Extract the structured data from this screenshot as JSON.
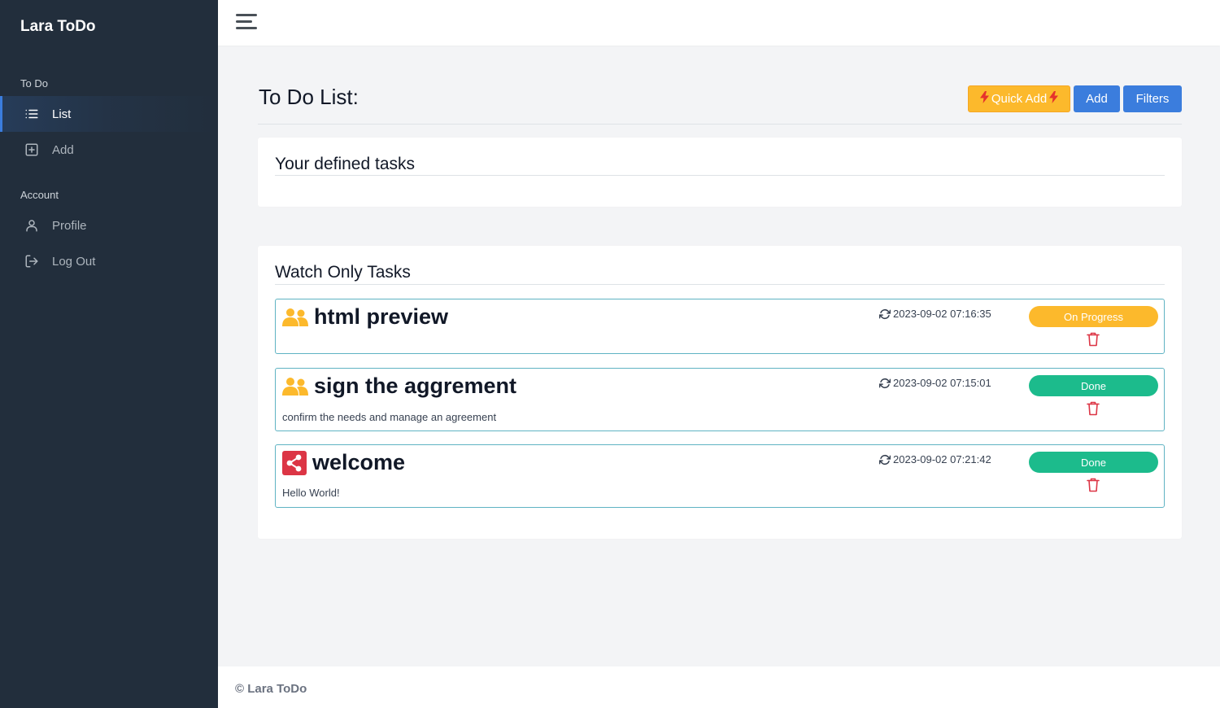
{
  "app": {
    "brand": "Lara ToDo"
  },
  "sidebar": {
    "sections": [
      {
        "header": "To Do",
        "items": [
          {
            "label": "List",
            "icon": "list-icon",
            "active": true
          },
          {
            "label": "Add",
            "icon": "plus-square-icon",
            "active": false
          }
        ]
      },
      {
        "header": "Account",
        "items": [
          {
            "label": "Profile",
            "icon": "user-icon",
            "active": false
          },
          {
            "label": "Log Out",
            "icon": "log-out-icon",
            "active": false
          }
        ]
      }
    ]
  },
  "main": {
    "title": "To Do List:",
    "buttons": {
      "quick_add": "Quick Add",
      "add": "Add",
      "filters": "Filters"
    },
    "defined_card": {
      "title": "Your defined tasks"
    },
    "watch_card": {
      "title": "Watch Only Tasks",
      "tasks": [
        {
          "title": "html preview",
          "icon": "users-icon",
          "description": "",
          "timestamp": "2023-09-02 07:16:35",
          "status": "On Progress"
        },
        {
          "title": "sign the aggrement",
          "icon": "users-icon",
          "description": "confirm the needs and manage an agreement",
          "timestamp": "2023-09-02 07:15:01",
          "status": "Done"
        },
        {
          "title": "welcome",
          "icon": "share-icon",
          "description": "Hello World!",
          "timestamp": "2023-09-02 07:21:42",
          "status": "Done"
        }
      ]
    }
  },
  "footer": {
    "text": "© Lara ToDo"
  },
  "colors": {
    "sidebar_bg": "#222e3c",
    "primary": "#3b7ddd",
    "warning": "#fcb92c",
    "success": "#1cbb8c",
    "danger": "#dc3545",
    "task_border": "#5fb3c3"
  }
}
